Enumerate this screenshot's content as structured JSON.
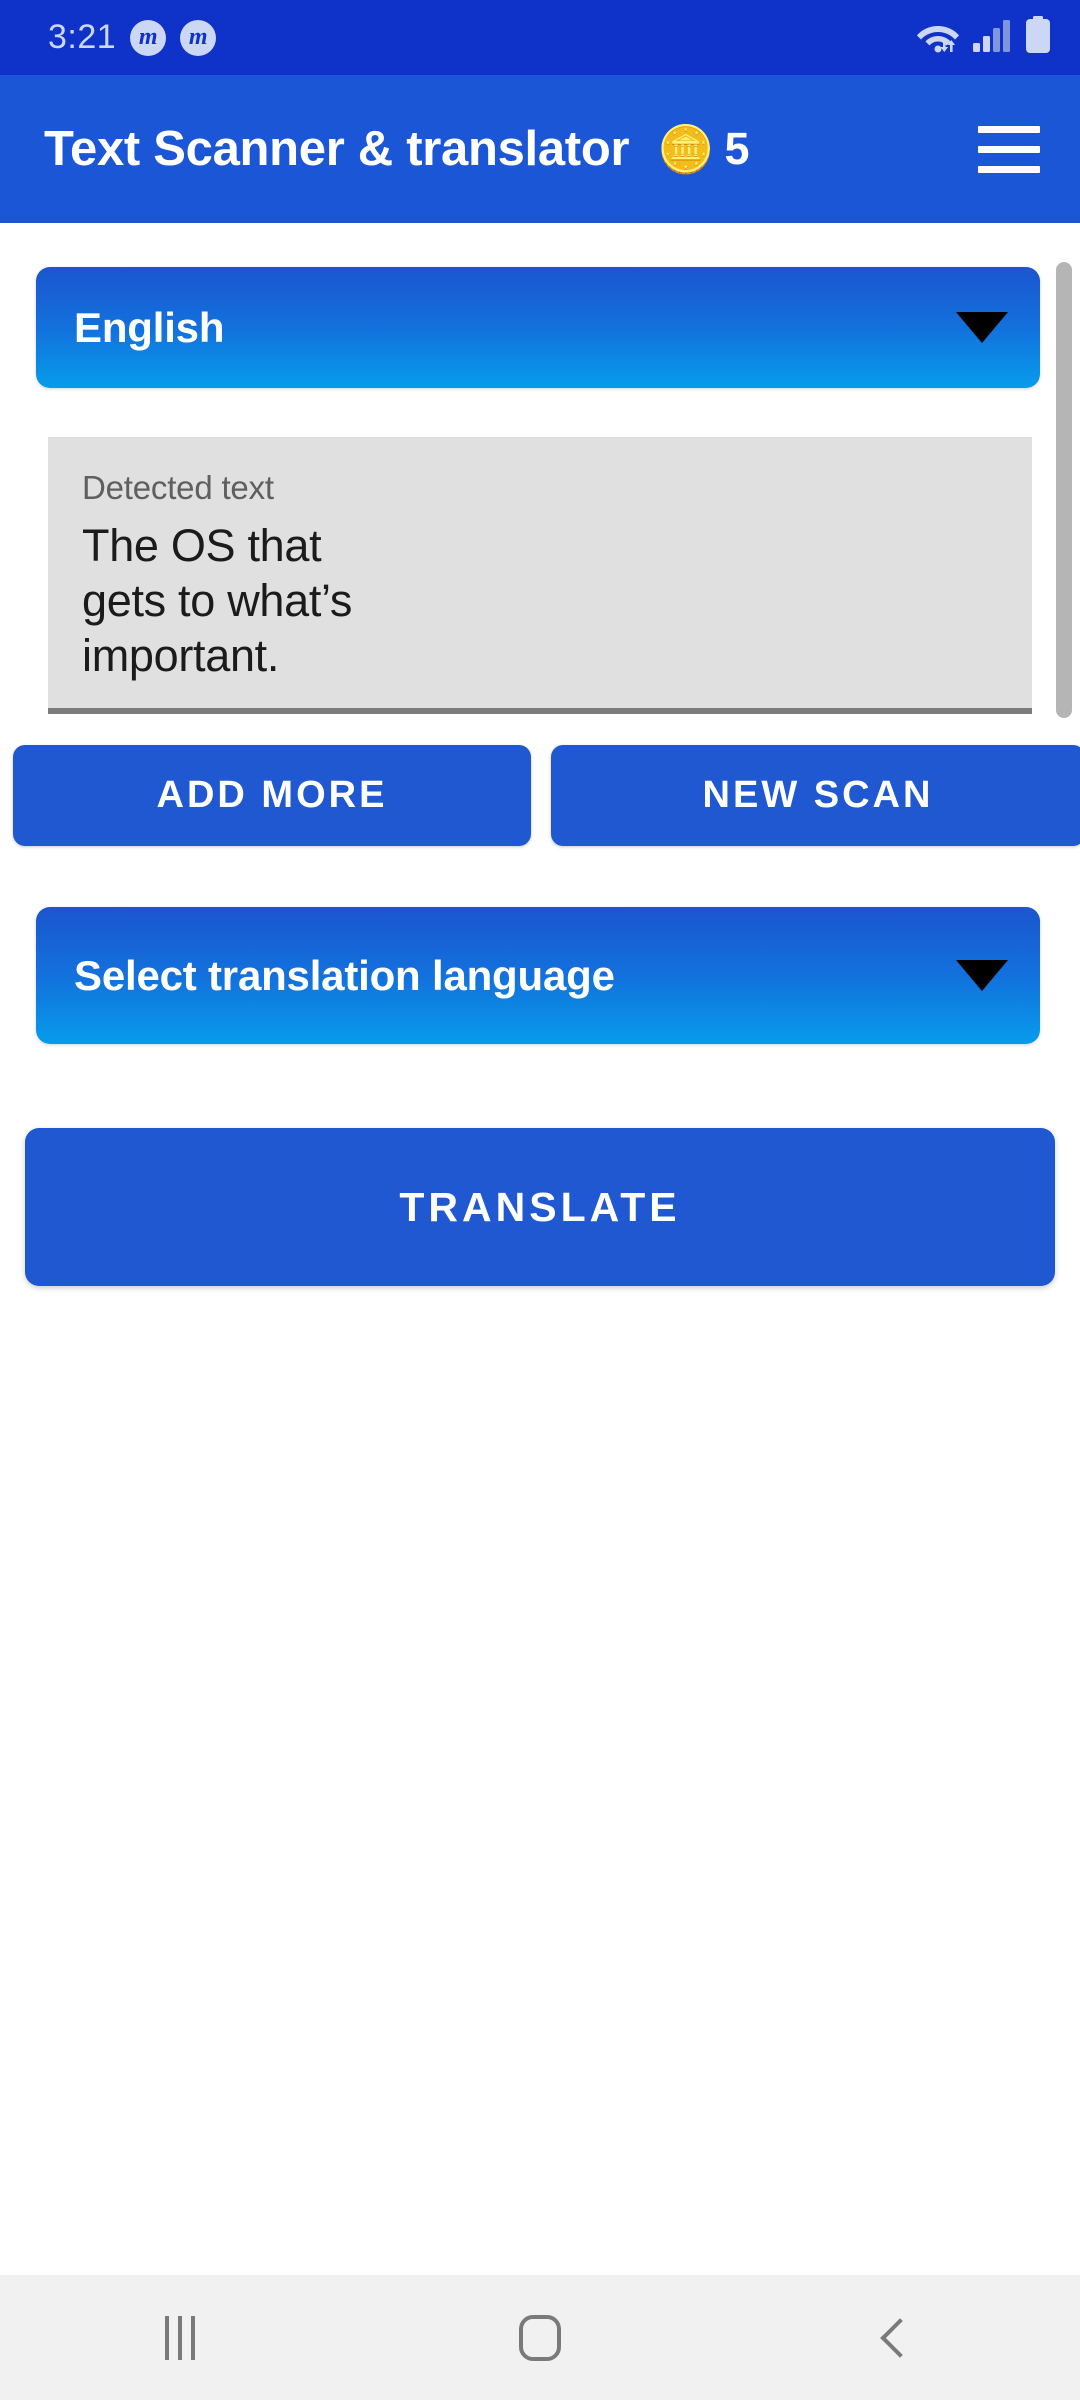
{
  "status_bar": {
    "clock": "3:21",
    "notification_badges": [
      "m",
      "m"
    ],
    "icons": [
      "wifi-icon",
      "cellular-signal-icon",
      "battery-icon"
    ],
    "background_color": "#0f32c8"
  },
  "app_bar": {
    "title": "Text Scanner & translator",
    "coin_icon": "🪙",
    "coin_count": "5",
    "menu_icon": "hamburger-menu-icon",
    "background_color": "#1a56d6"
  },
  "main": {
    "source_language": {
      "label": "English",
      "caret_icon": "chevron-down-icon"
    },
    "detected_text_field": {
      "label": "Detected text",
      "value": "The OS that\ngets to what’s\nimportant."
    },
    "buttons": {
      "add_more": "ADD MORE",
      "new_scan": "NEW SCAN",
      "translate": "TRANSLATE"
    },
    "target_language": {
      "label": "Select translation language",
      "caret_icon": "chevron-down-icon"
    },
    "accent_color": "#1f58d0",
    "gradient_top": "#1b55cf",
    "gradient_bottom": "#079ceb"
  },
  "nav_bar": {
    "recents": "recents-icon",
    "home": "home-icon",
    "back": "back-icon",
    "background_color": "#f1f1f1"
  }
}
